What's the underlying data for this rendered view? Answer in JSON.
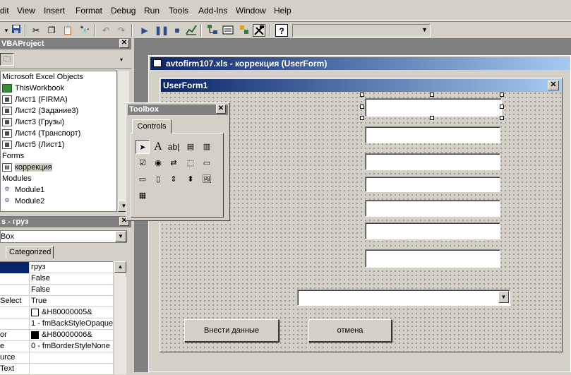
{
  "menu": [
    "dit",
    "View",
    "Insert",
    "Format",
    "Debug",
    "Run",
    "Tools",
    "Add-Ins",
    "Window",
    "Help"
  ],
  "toolbar_icons": [
    "save-icon",
    "cut-icon",
    "copy-icon",
    "paste-icon",
    "find-icon",
    "undo-icon",
    "redo-icon",
    "run-icon",
    "pause-icon",
    "stop-icon",
    "design-mode-icon",
    "project-explorer-icon",
    "properties-icon",
    "object-browser-icon",
    "toolbox-icon",
    "help-icon"
  ],
  "project": {
    "title": "VBAProject",
    "items": [
      {
        "label": "Microsoft Excel Objects",
        "icon": ""
      },
      {
        "label": "ThisWorkbook",
        "icon": "workbook-icon"
      },
      {
        "label": "Лист1 (FIRMA)",
        "icon": "sheet-icon"
      },
      {
        "label": "Лист2 (Задание3)",
        "icon": "sheet-icon"
      },
      {
        "label": "Лист3 (Грузы)",
        "icon": "sheet-icon"
      },
      {
        "label": "Лист4 (Транспорт)",
        "icon": "sheet-icon"
      },
      {
        "label": "Лист5 (Лист1)",
        "icon": "sheet-icon"
      },
      {
        "label": "Forms",
        "icon": ""
      },
      {
        "label": "коррекция",
        "icon": "form-icon"
      },
      {
        "label": "Modules",
        "icon": ""
      },
      {
        "label": "Module1",
        "icon": "module-icon"
      },
      {
        "label": "Module2",
        "icon": "module-icon"
      }
    ]
  },
  "properties": {
    "title": "s - груз",
    "object": "Box",
    "tab": "Categorized",
    "rows": [
      {
        "name": "",
        "value": "груз",
        "swatch": ""
      },
      {
        "name": "",
        "value": "False",
        "swatch": ""
      },
      {
        "name": "",
        "value": "False",
        "swatch": ""
      },
      {
        "name": "Select",
        "value": "True",
        "swatch": ""
      },
      {
        "name": "",
        "value": "&H80000005&",
        "swatch": "#ffffff"
      },
      {
        "name": "",
        "value": "1 - fmBackStyleOpaque",
        "swatch": ""
      },
      {
        "name": "or",
        "value": "&H80000006&",
        "swatch": "#000000"
      },
      {
        "name": "e",
        "value": "0 - fmBorderStyleNone",
        "swatch": ""
      },
      {
        "name": "urce",
        "value": "",
        "swatch": ""
      },
      {
        "name": "Text",
        "value": "",
        "swatch": ""
      }
    ]
  },
  "designer": {
    "title": "avtofirm107.xls - коррекция (UserForm)"
  },
  "userform": {
    "title": "UserForm1",
    "buttons": {
      "submit": "Внести данные",
      "cancel": "отмена"
    }
  },
  "toolbox": {
    "title": "Toolbox",
    "tab": "Controls",
    "tools": [
      "A",
      "ab|"
    ]
  }
}
